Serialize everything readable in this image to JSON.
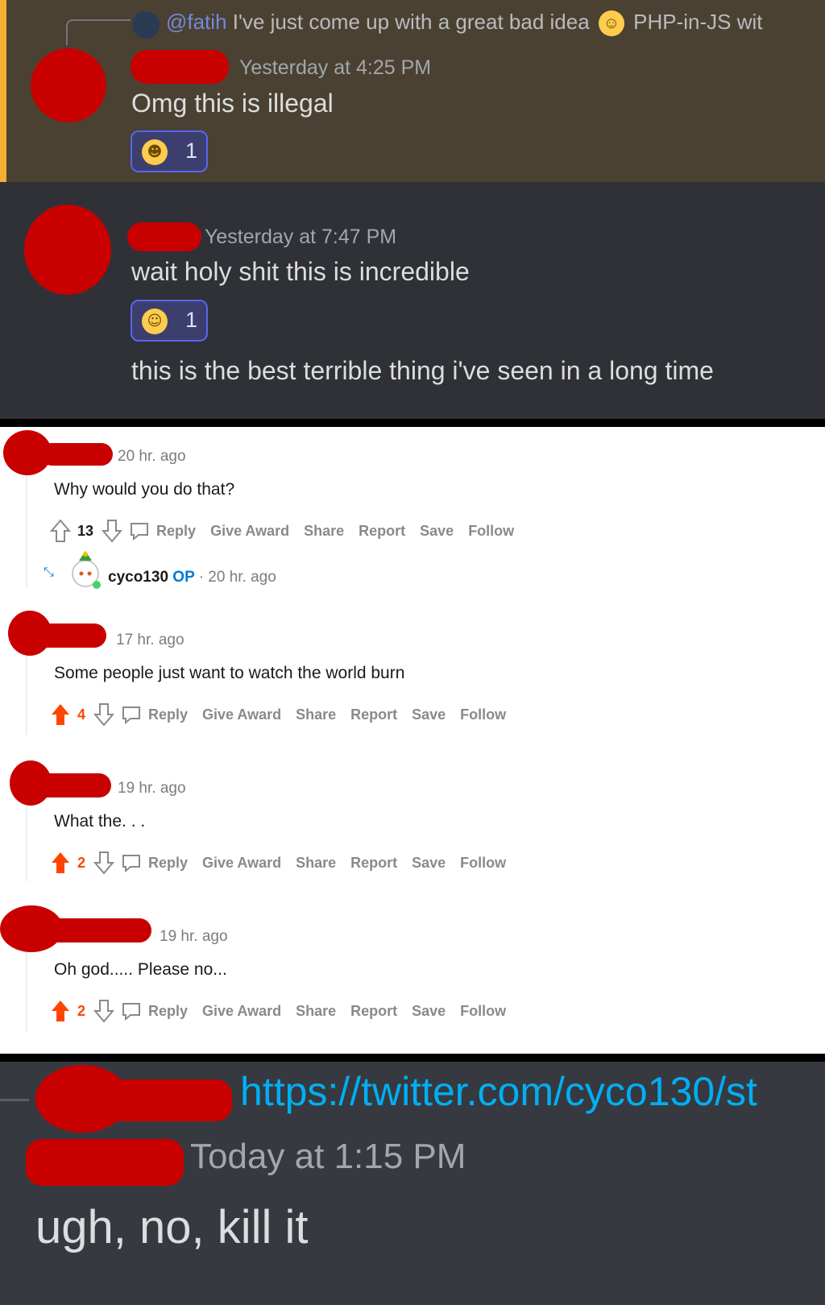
{
  "discord_top": {
    "reply_preview": {
      "mention": "@fatih",
      "text": "I've just come up with a great bad idea",
      "after_emoji": "PHP-in-JS wit"
    },
    "message1": {
      "timestamp": "Yesterday at 4:25 PM",
      "text": "Omg this is illegal",
      "reaction_count": "1",
      "reaction_emoji": "joy"
    },
    "message2": {
      "timestamp": "Yesterday at 7:47 PM",
      "text": "wait holy shit this is incredible",
      "reaction_count": "1",
      "reaction_emoji": "grin",
      "followup": "this is the best terrible thing i've seen in a long time"
    }
  },
  "reddit": {
    "comments": [
      {
        "timestamp": "20 hr. ago",
        "body": "Why would you do that?",
        "score": "13",
        "upvoted": false
      },
      {
        "timestamp": "17 hr. ago",
        "body": "Some people just want to watch the world burn",
        "score": "4",
        "upvoted": true
      },
      {
        "timestamp": "19 hr. ago",
        "body": "What the. . .",
        "score": "2",
        "upvoted": true
      },
      {
        "timestamp": "19 hr. ago",
        "body": "Oh god..... Please no...",
        "score": "2",
        "upvoted": true
      }
    ],
    "op": {
      "username": "cyco130",
      "badge": "OP",
      "timestamp": "20 hr. ago"
    },
    "actions": {
      "reply": "Reply",
      "award": "Give Award",
      "share": "Share",
      "report": "Report",
      "save": "Save",
      "follow": "Follow"
    },
    "colors": {
      "upvote": "#ff4500",
      "neutral": "#878a8c"
    }
  },
  "discord_bottom": {
    "link": "https://twitter.com/cyco130/st",
    "timestamp": "Today at 1:15 PM",
    "text": "ugh, no, kill it"
  }
}
